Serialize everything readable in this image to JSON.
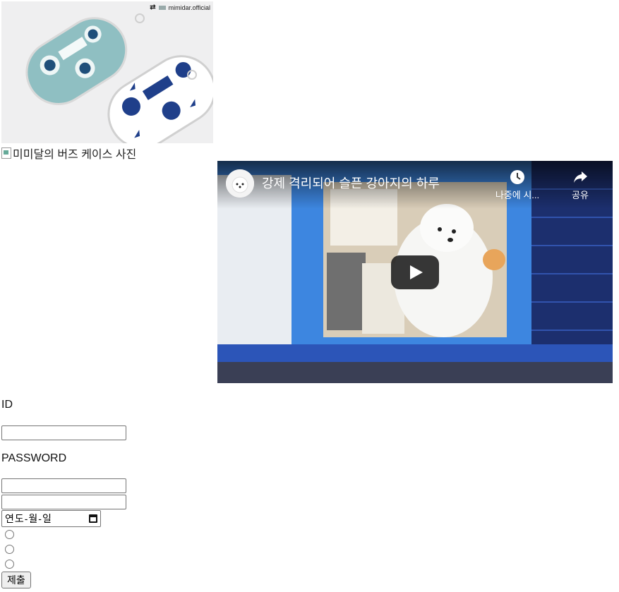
{
  "top_link": {
    "text": ""
  },
  "photo": {
    "repost_account": "mimidar.official",
    "alt": "미미달의 버즈 케이스 사진"
  },
  "video": {
    "title": "강제 격리되어 슬픈 강아지의 하루",
    "watch_later_label": "나중에 시...",
    "share_label": "공유"
  },
  "form": {
    "id_label": "ID",
    "id_value": "",
    "password_label": "PASSWORD",
    "password_value": "",
    "extra_value": "",
    "date_placeholder": "연도-월-일",
    "radio_count": 3,
    "submit_label": "제출"
  },
  "colors": {
    "link": "#0000ee",
    "video_bg": "#1b3d8c"
  }
}
